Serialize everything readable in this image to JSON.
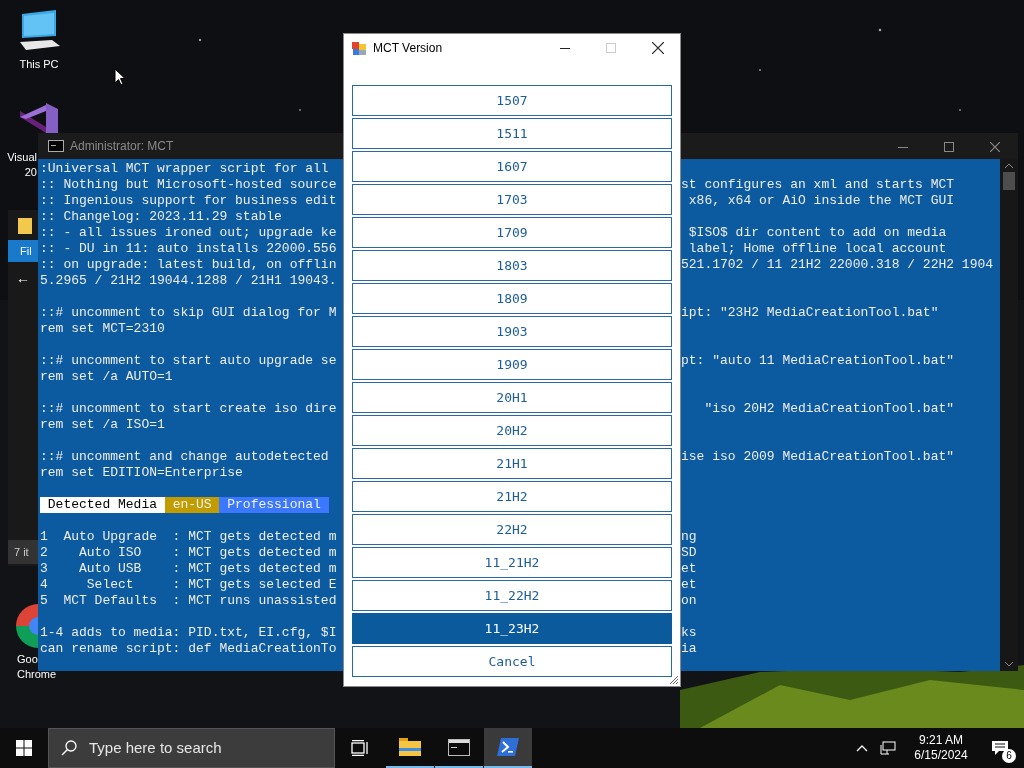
{
  "desktop": {
    "icons": [
      {
        "kind": "pc",
        "label_lines": [
          "This PC"
        ]
      },
      {
        "kind": "vs",
        "label_lines": [
          "Visual",
          "20"
        ]
      },
      {
        "kind": "chrome",
        "label_lines": [
          "Goo",
          "Chrome"
        ]
      }
    ]
  },
  "explorer_behind": {
    "tab": "Fil",
    "back": "←",
    "status": "7 it"
  },
  "console": {
    "title": "Administrator: MCT",
    "lines": [
      {
        "kind": "text",
        "left": ":Universal MCT wrapper script for all"
      },
      {
        "kind": "text",
        "left": ":: Nothing but Microsoft-hosted source",
        "right": "st configures an xml and starts MCT"
      },
      {
        "kind": "text",
        "left": ":: Ingenious support for business edit",
        "right": " x86, x64 or AiO inside the MCT GUI"
      },
      {
        "kind": "text",
        "left": ":: Changelog: 2023.11.29 stable"
      },
      {
        "kind": "text",
        "left": ":: - all issues ironed out; upgrade ke",
        "right": " $ISO$ dir content to add on media"
      },
      {
        "kind": "text",
        "left": ":: - DU in 11: auto installs 22000.556",
        "right": " label; Home offline local account"
      },
      {
        "kind": "text",
        "left": ":: on upgrade: latest build, on offlin",
        "right": "521.1702 / 11 21H2 22000.318 / 22H2 1904"
      },
      {
        "kind": "text",
        "left": "5.2965 / 21H2 19044.1288 / 21H1 19043."
      },
      {
        "kind": "blank"
      },
      {
        "kind": "text",
        "left": "::# uncomment to skip GUI dialog for M",
        "right": "ipt: \"23H2 MediaCreationTool.bat\""
      },
      {
        "kind": "text",
        "left": "rem set MCT=2310"
      },
      {
        "kind": "blank"
      },
      {
        "kind": "text",
        "left": "::# uncomment to start auto upgrade se",
        "right": "pt: \"auto 11 MediaCreationTool.bat\""
      },
      {
        "kind": "text",
        "left": "rem set /a AUTO=1"
      },
      {
        "kind": "blank"
      },
      {
        "kind": "text",
        "left": "::# uncomment to start create iso dire",
        "right": "   \"iso 20H2 MediaCreationTool.bat\""
      },
      {
        "kind": "text",
        "left": "rem set /a ISO=1"
      },
      {
        "kind": "blank"
      },
      {
        "kind": "text",
        "left": "::# uncomment and change autodetected",
        "right": "ise iso 2009 MediaCreationTool.bat\""
      },
      {
        "kind": "text",
        "left": "rem set EDITION=Enterprise"
      },
      {
        "kind": "blank"
      },
      {
        "kind": "banner",
        "tags": [
          {
            "text": " Detected Media ",
            "color": "#ffffff"
          },
          {
            "text": " en-US ",
            "color": "#c19c00"
          },
          {
            "text": " Professional ",
            "color": "#3b78ff"
          }
        ]
      },
      {
        "kind": "blank"
      },
      {
        "kind": "text",
        "left": "1  Auto Upgrade  : MCT gets detected m",
        "right": "ng"
      },
      {
        "kind": "text",
        "left": "2    Auto ISO    : MCT gets detected m",
        "right": "SD"
      },
      {
        "kind": "text",
        "left": "3    Auto USB    : MCT gets detected m",
        "right": "et"
      },
      {
        "kind": "text",
        "left": "4     Select     : MCT gets selected E",
        "right": "et"
      },
      {
        "kind": "text",
        "left": "5  MCT Defaults  : MCT runs unassisted",
        "right": "on"
      },
      {
        "kind": "blank"
      },
      {
        "kind": "text",
        "left": "1-4 adds to media: PID.txt, EI.cfg, $I",
        "right": "ks"
      },
      {
        "kind": "text",
        "left": "can rename script: def MediaCreationTo",
        "right": "ia"
      }
    ]
  },
  "dialog": {
    "title": "MCT Version",
    "options": [
      {
        "label": "1507",
        "selected": false
      },
      {
        "label": "1511",
        "selected": false
      },
      {
        "label": "1607",
        "selected": false
      },
      {
        "label": "1703",
        "selected": false
      },
      {
        "label": "1709",
        "selected": false
      },
      {
        "label": "1803",
        "selected": false
      },
      {
        "label": "1809",
        "selected": false
      },
      {
        "label": "1903",
        "selected": false
      },
      {
        "label": "1909",
        "selected": false
      },
      {
        "label": "20H1",
        "selected": false
      },
      {
        "label": "20H2",
        "selected": false
      },
      {
        "label": "21H1",
        "selected": false
      },
      {
        "label": "21H2",
        "selected": false
      },
      {
        "label": "22H2",
        "selected": false
      },
      {
        "label": "11_21H2",
        "selected": false
      },
      {
        "label": "11_22H2",
        "selected": false
      },
      {
        "label": "11_23H2",
        "selected": true
      }
    ],
    "cancel": "Cancel"
  },
  "taskbar": {
    "search_placeholder": "Type here to search",
    "apps": [
      {
        "kind": "explorer",
        "selected": false
      },
      {
        "kind": "console",
        "selected": false
      },
      {
        "kind": "powershell",
        "selected": true
      }
    ],
    "time": "9:21 AM",
    "date": "6/15/2024",
    "notifications": "6"
  }
}
